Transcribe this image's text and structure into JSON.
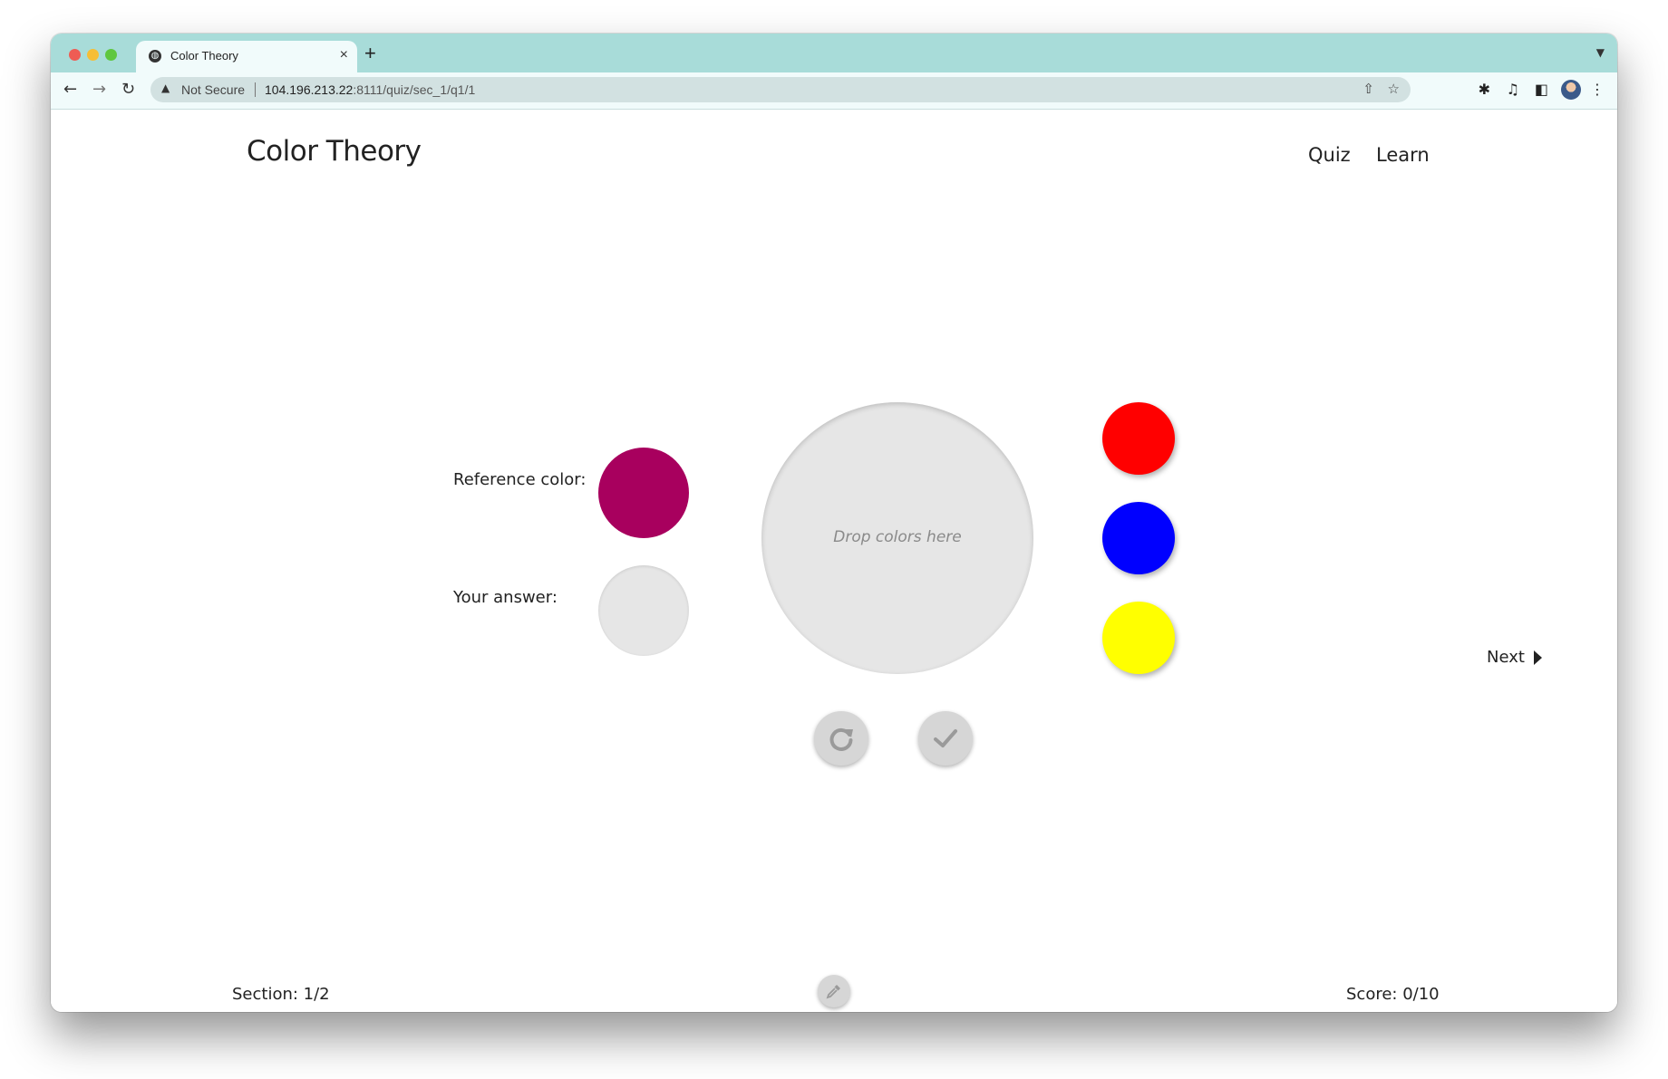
{
  "browser": {
    "tab_title": "Color Theory",
    "tab_close": "×",
    "new_tab": "+",
    "security_label": "Not Secure",
    "url_host": "104.196.213.22",
    "url_path": ":8111/quiz/sec_1/q1/1",
    "icons": [
      "back-icon",
      "forward-icon",
      "reload-icon",
      "warning-icon",
      "share-icon",
      "star-icon",
      "extensions-icon",
      "media-icon",
      "side-panel-icon",
      "profile-avatar",
      "menu-icon"
    ]
  },
  "header": {
    "brand": "Color Theory",
    "nav": [
      "Quiz",
      "Learn"
    ]
  },
  "quiz": {
    "reference_label": "Reference color:",
    "answer_label": "Your answer:",
    "drop_placeholder": "Drop colors here",
    "colors": {
      "reference": "#a8005e",
      "answer": "#e6e6e6",
      "palette": [
        "#ff0000",
        "#0000ff",
        "#ffff00"
      ]
    },
    "actions": [
      "reset",
      "check"
    ],
    "next_label": "Next"
  },
  "footer": {
    "section": "Section: 1/2",
    "score": "Score: 0/10",
    "tool": "eyedropper"
  }
}
